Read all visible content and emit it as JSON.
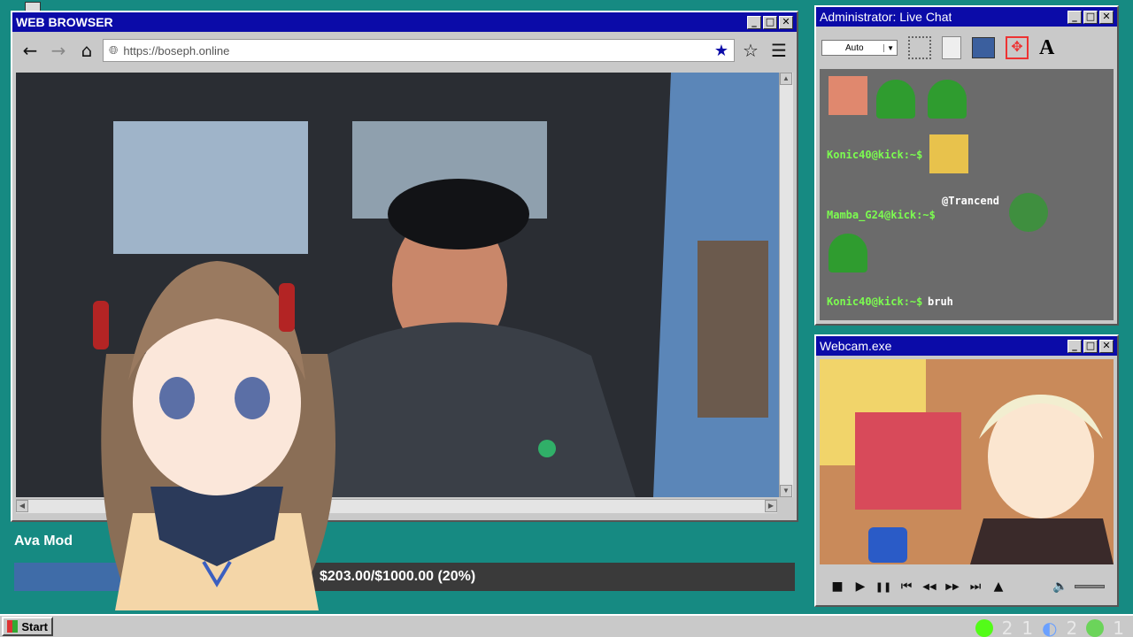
{
  "browser": {
    "title": "WEB BROWSER",
    "url": "https://boseph.online",
    "min": "_",
    "max": "□",
    "close": "✕",
    "back": "←",
    "forward": "→",
    "home": "⌂",
    "bookmarked": "★",
    "bookmark": "☆",
    "menu": "☰"
  },
  "chat": {
    "title": "Administrator: Live Chat",
    "font_select": "Auto",
    "tool_text": "A",
    "messages": [
      {
        "user": "Konic40@kick:~$",
        "text": ""
      },
      {
        "user": "Mamba_G24@kick:~$",
        "text": "@Trancend"
      },
      {
        "user": "Konic40@kick:~$",
        "text": "bruh"
      }
    ]
  },
  "webcam": {
    "title": "Webcam.exe",
    "stop": "■",
    "play": "▶",
    "pause": "❚❚",
    "prev": "⏮",
    "rew": "◀◀",
    "ff": "▶▶",
    "next": "⏭",
    "eject": "▲",
    "volume": "🔈"
  },
  "goal": {
    "name": "Ava Mod",
    "progress_text": "$203.00/$1000.00 (20%)",
    "progress": 0.2
  },
  "taskbar": {
    "start": "Start",
    "tray_counts": [
      "2",
      "1",
      "2",
      "1"
    ]
  },
  "colors": {
    "desktop": "#168a82",
    "titlebar": "#0b0ba8",
    "chat_user": "#7CFC50"
  }
}
